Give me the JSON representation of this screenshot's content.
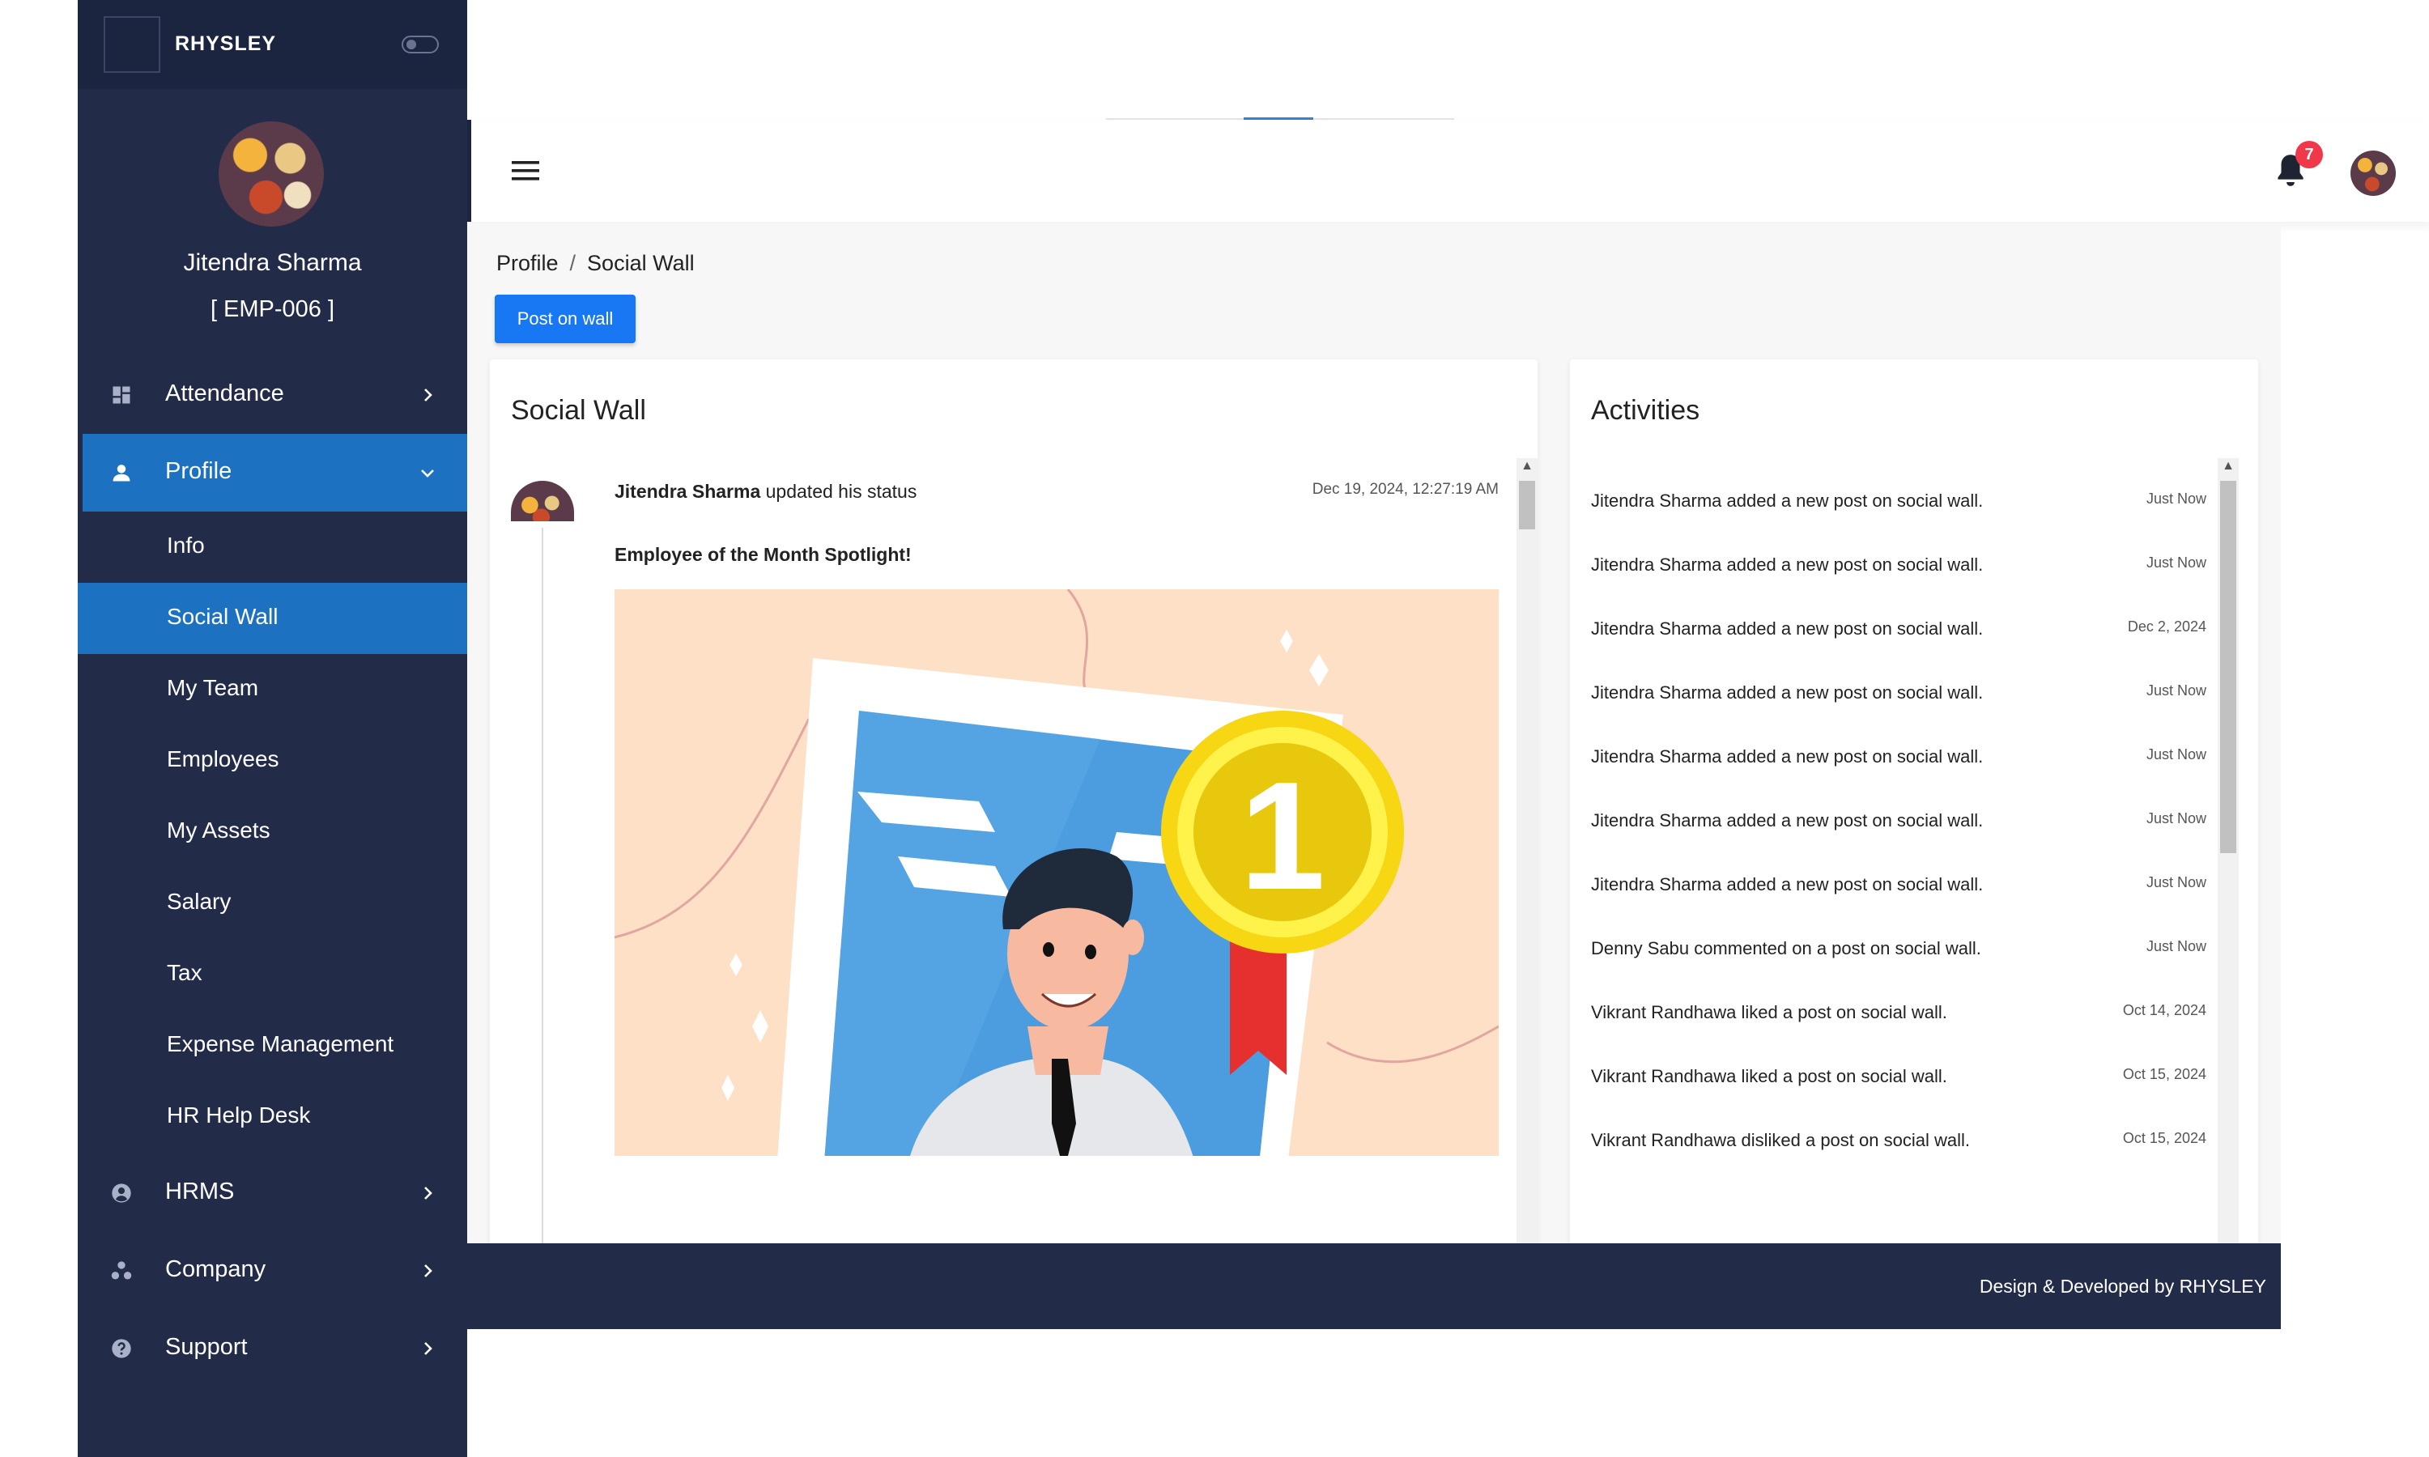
{
  "brand": {
    "name": "RHYSLEY"
  },
  "user": {
    "name": "Jitendra Sharma",
    "code": "[ EMP-006 ]"
  },
  "sidebar": {
    "top_items": [
      {
        "label": "Attendance",
        "icon": "dashboard-icon"
      },
      {
        "label": "Profile",
        "icon": "person-icon"
      }
    ],
    "profile_sub": [
      "Info",
      "Social Wall",
      "My Team",
      "Employees",
      "My Assets",
      "Salary",
      "Tax",
      "Expense Management",
      "HR Help Desk"
    ],
    "bottom_items": [
      {
        "label": "HRMS",
        "icon": "account-circle-icon"
      },
      {
        "label": "Company",
        "icon": "group-icon"
      },
      {
        "label": "Support",
        "icon": "help-icon"
      }
    ]
  },
  "topbar": {
    "notification_count": "7"
  },
  "breadcrumb": {
    "parent": "Profile",
    "separator": "/",
    "current": "Social Wall"
  },
  "post_button": "Post on wall",
  "wall": {
    "title": "Social Wall",
    "post": {
      "author": "Jitendra Sharma",
      "action": " updated his status",
      "time": "Dec 19, 2024, 12:27:19 AM",
      "title": "Employee of the Month Spotlight!",
      "badge_number": "1"
    }
  },
  "activities": {
    "title": "Activities",
    "items": [
      {
        "text": "Jitendra Sharma added a new post on social wall.",
        "time": "Just Now"
      },
      {
        "text": "Jitendra Sharma added a new post on social wall.",
        "time": "Just Now"
      },
      {
        "text": "Jitendra Sharma added a new post on social wall.",
        "time": "Dec 2, 2024"
      },
      {
        "text": "Jitendra Sharma added a new post on social wall.",
        "time": "Just Now"
      },
      {
        "text": "Jitendra Sharma added a new post on social wall.",
        "time": "Just Now"
      },
      {
        "text": "Jitendra Sharma added a new post on social wall.",
        "time": "Just Now"
      },
      {
        "text": "Jitendra Sharma added a new post on social wall.",
        "time": "Just Now"
      },
      {
        "text": "Denny Sabu commented on a post on social wall.",
        "time": "Just Now"
      },
      {
        "text": "Vikrant Randhawa liked a post on social wall.",
        "time": "Oct 14, 2024"
      },
      {
        "text": "Vikrant Randhawa liked a post on social wall.",
        "time": "Oct 15, 2024"
      },
      {
        "text": "Vikrant Randhawa disliked a post on social wall.",
        "time": "Oct 15, 2024"
      }
    ]
  },
  "footer": {
    "text": "Design & Developed by  RHYSLEY"
  },
  "colors": {
    "sidebar": "#222b48",
    "accent": "#1d71c1",
    "button": "#1877f2",
    "badge": "#f0384a"
  }
}
